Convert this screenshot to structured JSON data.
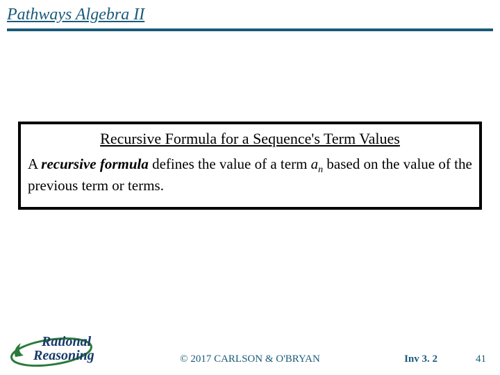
{
  "header": {
    "title": "Pathways Algebra II"
  },
  "content": {
    "box_heading": "Recursive Formula for a Sequence's Term Values",
    "lead_a": "A ",
    "lead_bold": "recursive formula",
    "lead_b": " defines the value of a term ",
    "term_var": "a",
    "term_sub": "n",
    "lead_c": " based on the value of the previous term or terms."
  },
  "footer": {
    "logo_top": "Rational",
    "logo_bottom": "Reasoning",
    "copyright": "© 2017 CARLSON & O'BRYAN",
    "inv": "Inv 3. 2",
    "page": "41"
  }
}
